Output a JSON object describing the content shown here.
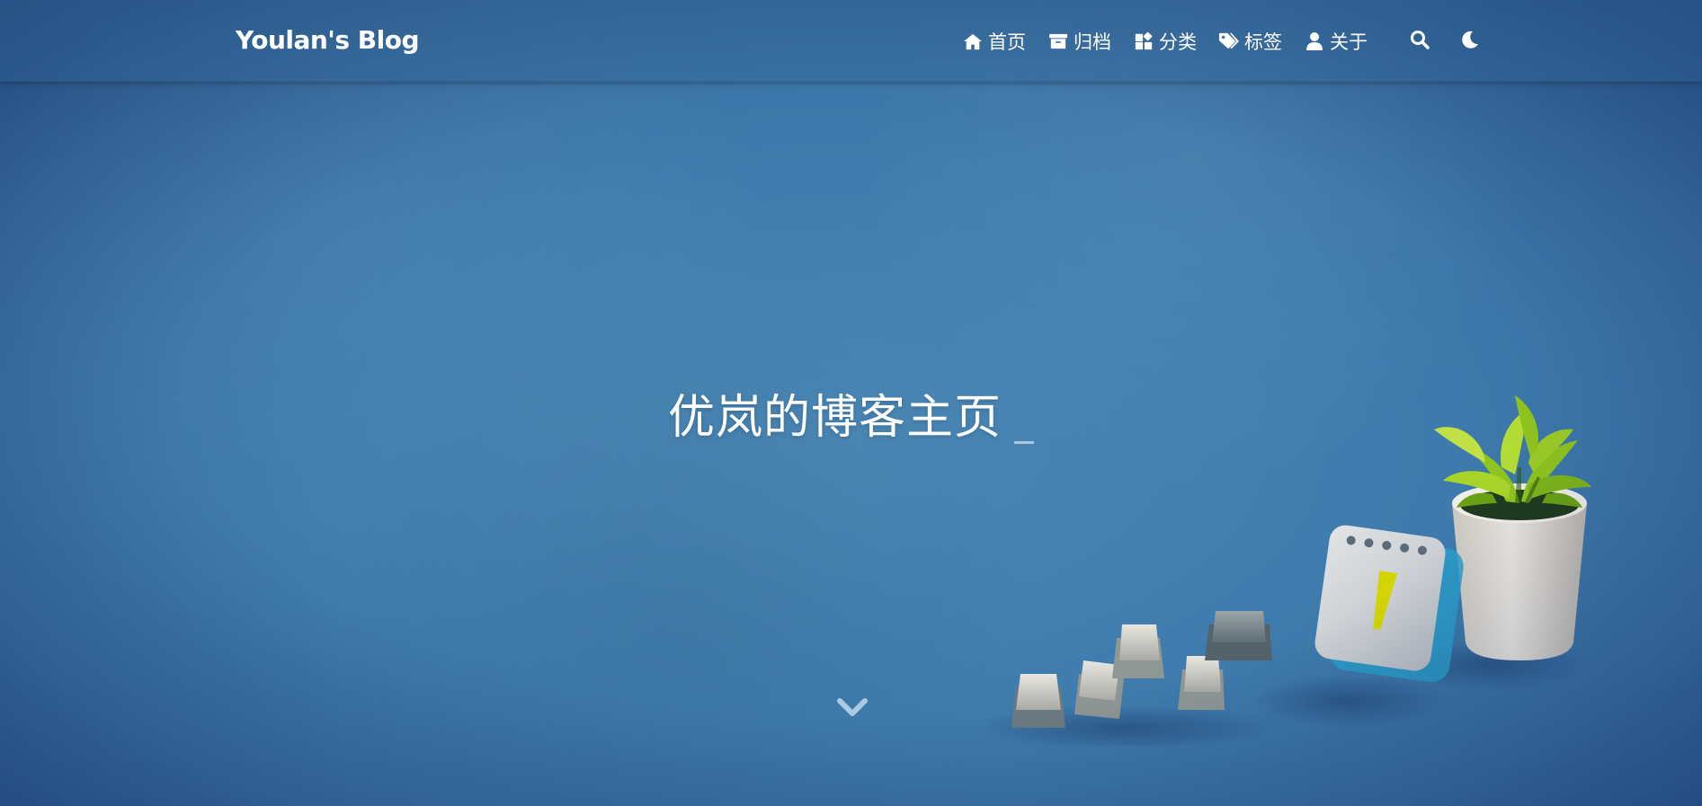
{
  "site": {
    "brand": "Youlan's Blog"
  },
  "nav": {
    "items": [
      {
        "label": "首页",
        "icon": "home-icon"
      },
      {
        "label": "归档",
        "icon": "archive-icon"
      },
      {
        "label": "分类",
        "icon": "category-icon"
      },
      {
        "label": "标签",
        "icon": "tag-icon"
      },
      {
        "label": "关于",
        "icon": "user-icon"
      }
    ],
    "search_icon": "search-icon",
    "theme_icon": "moon-icon"
  },
  "hero": {
    "title": "优岚的博客主页",
    "scroll_icon": "chevron-down-icon"
  },
  "colors": {
    "background": "#3f7cad",
    "text": "#ffffff",
    "plant_leaf": "#8fc31f",
    "calendar_accent": "#d4d400"
  }
}
